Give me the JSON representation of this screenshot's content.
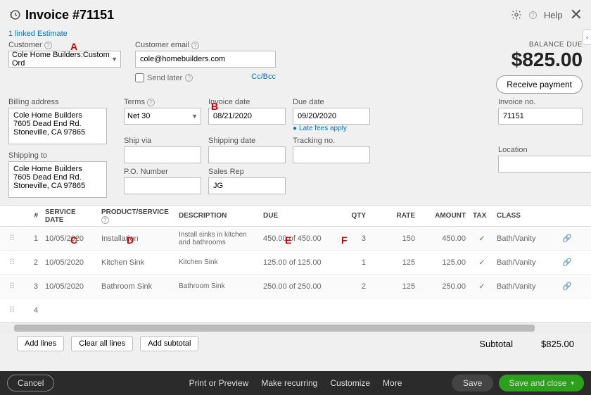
{
  "header": {
    "title": "Invoice #71151",
    "help_label": "Help"
  },
  "linked_estimate": "1 linked Estimate",
  "annotations": {
    "a": "A",
    "b": "B",
    "c": "C",
    "d": "D",
    "e": "E",
    "f": "F"
  },
  "customer": {
    "label": "Customer",
    "value": "Cole Home Builders:Custom Ord"
  },
  "email": {
    "label": "Customer email",
    "value": "cole@homebuilders.com",
    "send_later": "Send later",
    "ccbcc": "Cc/Bcc"
  },
  "balance": {
    "label": "BALANCE DUE",
    "amount": "$825.00",
    "receive_payment": "Receive payment"
  },
  "billing": {
    "label": "Billing address",
    "value": "Cole Home Builders\n7605 Dead End Rd.\nStoneville, CA 97865"
  },
  "shipping": {
    "label": "Shipping to",
    "value": "Cole Home Builders\n7605 Dead End Rd.\nStoneville, CA 97865"
  },
  "terms": {
    "label": "Terms",
    "value": "Net 30"
  },
  "invoice_date": {
    "label": "Invoice date",
    "value": "08/21/2020"
  },
  "due_date": {
    "label": "Due date",
    "value": "09/20/2020"
  },
  "late_fees": "Late fees apply",
  "ship_via": {
    "label": "Ship via",
    "value": ""
  },
  "shipping_date": {
    "label": "Shipping date",
    "value": ""
  },
  "tracking": {
    "label": "Tracking no.",
    "value": ""
  },
  "po": {
    "label": "P.O. Number",
    "value": ""
  },
  "sales_rep": {
    "label": "Sales Rep",
    "value": "JG"
  },
  "invoice_no": {
    "label": "Invoice no.",
    "value": "71151"
  },
  "location": {
    "label": "Location",
    "value": ""
  },
  "table": {
    "headers": {
      "num": "#",
      "service_date": "SERVICE DATE",
      "product": "PRODUCT/SERVICE",
      "description": "DESCRIPTION",
      "due": "DUE",
      "qty": "QTY",
      "rate": "RATE",
      "amount": "AMOUNT",
      "tax": "TAX",
      "class": "CLASS"
    },
    "rows": [
      {
        "n": "1",
        "date": "10/05/2020",
        "product": "Installation",
        "desc": "Install sinks in kitchen and bathrooms",
        "due": "450.00 of 450.00",
        "qty": "3",
        "rate": "150",
        "amount": "450.00",
        "tax": "✓",
        "class": "Bath/Vanity"
      },
      {
        "n": "2",
        "date": "10/05/2020",
        "product": "Kitchen Sink",
        "desc": "Kitchen Sink",
        "due": "125.00 of 125.00",
        "qty": "1",
        "rate": "125",
        "amount": "125.00",
        "tax": "✓",
        "class": "Bath/Vanity"
      },
      {
        "n": "3",
        "date": "10/05/2020",
        "product": "Bathroom Sink",
        "desc": "Bathroom Sink",
        "due": "250.00 of 250.00",
        "qty": "2",
        "rate": "125",
        "amount": "250.00",
        "tax": "✓",
        "class": "Bath/Vanity"
      },
      {
        "n": "4",
        "date": "",
        "product": "",
        "desc": "",
        "due": "",
        "qty": "",
        "rate": "",
        "amount": "",
        "tax": "",
        "class": ""
      }
    ]
  },
  "actions": {
    "add_lines": "Add lines",
    "clear_lines": "Clear all lines",
    "add_subtotal": "Add subtotal"
  },
  "subtotal": {
    "label": "Subtotal",
    "value": "$825.00"
  },
  "footer": {
    "cancel": "Cancel",
    "print": "Print or Preview",
    "recurring": "Make recurring",
    "customize": "Customize",
    "more": "More",
    "save": "Save",
    "save_close": "Save and close"
  }
}
